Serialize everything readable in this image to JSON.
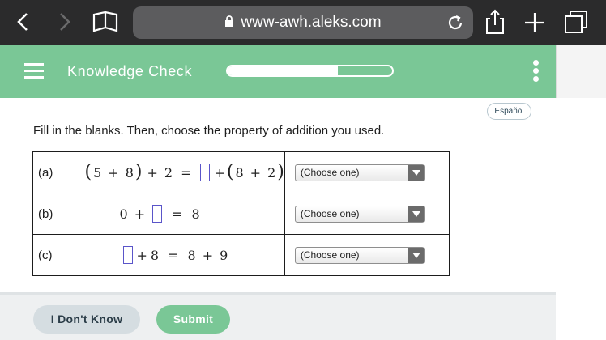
{
  "browser": {
    "url": "www-awh.aleks.com",
    "icons": [
      "back-icon",
      "forward-icon",
      "bookmarks-icon",
      "lock-icon",
      "reload-icon",
      "share-icon",
      "new-tab-icon",
      "tabs-icon"
    ]
  },
  "header": {
    "title": "Knowledge Check",
    "progress_fraction": 0.67,
    "accent_color": "#7ac796"
  },
  "language_button": "Español",
  "instruction": "Fill in the blanks. Then, choose the property of addition you used.",
  "rows": [
    {
      "label": "(a)",
      "expr": {
        "open1": "(",
        "a": "5",
        "plus1": "+",
        "b": "8",
        "close1": ")",
        "plus2": "+",
        "c": "2",
        "eq": "=",
        "plus3": "+",
        "open2": "(",
        "d": "8",
        "plus4": "+",
        "e": "2",
        "close2": ")"
      },
      "select": "(Choose one)"
    },
    {
      "label": "(b)",
      "expr": {
        "a": "0",
        "plus": "+",
        "eq": "=",
        "rhs": "8"
      },
      "select": "(Choose one)"
    },
    {
      "label": "(c)",
      "expr": {
        "plus1": "+",
        "a": "8",
        "eq": "=",
        "b": "8",
        "plus2": "+",
        "c": "9"
      },
      "select": "(Choose one)"
    }
  ],
  "footer": {
    "dont_know": "I Don't Know",
    "submit": "Submit"
  }
}
